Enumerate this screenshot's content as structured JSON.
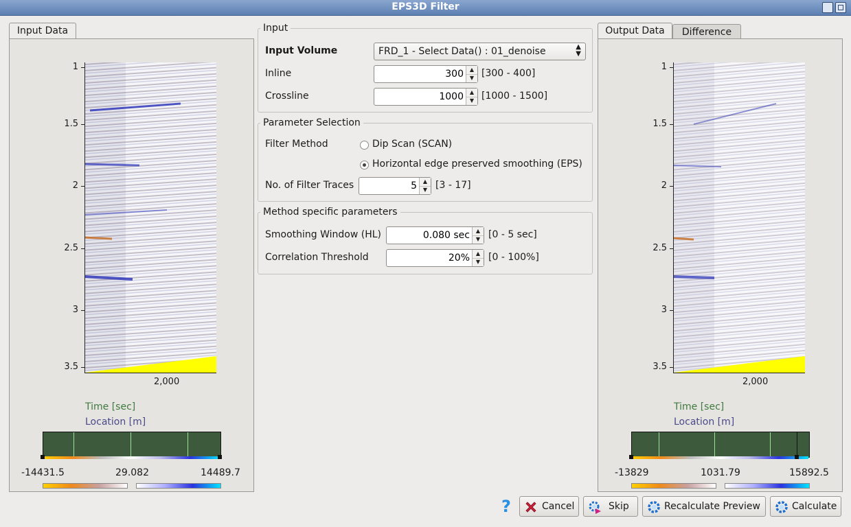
{
  "window": {
    "title": "EPS3D Filter"
  },
  "left_panel": {
    "tab_label": "Input Data",
    "y_ticks": [
      "1",
      "1.5",
      "2",
      "2.5",
      "3",
      "3.5"
    ],
    "x_tick": "2,000",
    "time_label": "Time [sec]",
    "location_label": "Location [m]",
    "cb_min": "-14431.5",
    "cb_mid": "29.082",
    "cb_max": "14489.7"
  },
  "right_panel": {
    "tab_output_label": "Output Data",
    "tab_difference_label": "Difference",
    "y_ticks": [
      "1",
      "1.5",
      "2",
      "2.5",
      "3",
      "3.5"
    ],
    "x_tick": "2,000",
    "time_label": "Time [sec]",
    "location_label": "Location [m]",
    "cb_min": "-13829",
    "cb_mid": "1031.79",
    "cb_max": "15892.5"
  },
  "input_group": {
    "title": "Input",
    "volume_label": "Input Volume",
    "volume_value": "FRD_1 - Select Data() : 01_denoise",
    "inline_label": "Inline",
    "inline_value": "300",
    "inline_range": "[300 - 400]",
    "crossline_label": "Crossline",
    "crossline_value": "1000",
    "crossline_range": "[1000 - 1500]"
  },
  "param_group": {
    "title": "Parameter Selection",
    "method_label": "Filter Method",
    "option_scan": "Dip Scan (SCAN)",
    "option_eps": "Horizontal edge preserved smoothing (EPS)",
    "selected": "eps",
    "traces_label": "No. of Filter Traces",
    "traces_value": "5",
    "traces_range": "[3 - 17]"
  },
  "method_group": {
    "title": "Method specific parameters",
    "smoothing_label": "Smoothing Window (HL)",
    "smoothing_value": "0.080 sec",
    "smoothing_range": "[0 - 5 sec]",
    "correlation_label": "Correlation Threshold",
    "correlation_value": "20%",
    "correlation_range": "[0 - 100%]"
  },
  "buttons": {
    "help_icon": "question-mark",
    "cancel": "Cancel",
    "skip": "Skip",
    "recalculate": "Recalculate Preview",
    "calculate": "Calculate"
  },
  "colors": {
    "title_bar": "#5d7fb2",
    "time_label": "#3f7a3f",
    "location_label": "#4a4a8a",
    "accent_blue": "#2a32b8"
  }
}
